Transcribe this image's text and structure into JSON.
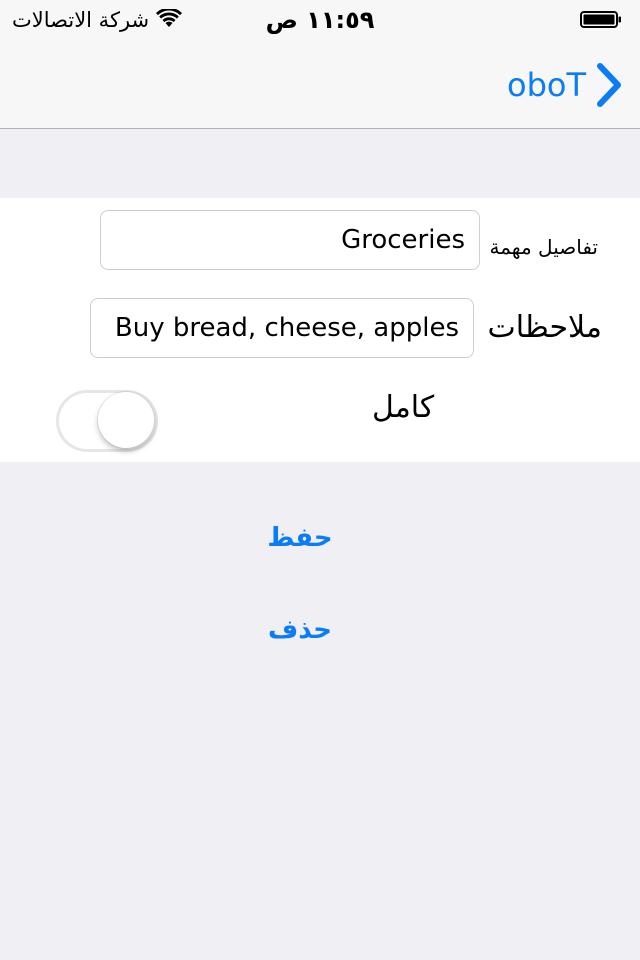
{
  "status_bar": {
    "carrier": "شركة الاتصالات",
    "time": "١١:٥٩ ص",
    "wifi_icon": "wifi-icon",
    "battery_icon": "battery-full-icon"
  },
  "nav": {
    "back_label": "oboT",
    "back_icon": "chevron-right-icon",
    "accent": "#0a7cf5"
  },
  "form": {
    "task_label": "تفاصيل مهمة",
    "task_value": "Groceries",
    "notes_label": "ملاحظات",
    "notes_value": "Buy bread, cheese, apples",
    "complete_label": "كامل",
    "complete_on": false
  },
  "actions": {
    "save_label": "حفظ",
    "delete_label": "حذف"
  }
}
